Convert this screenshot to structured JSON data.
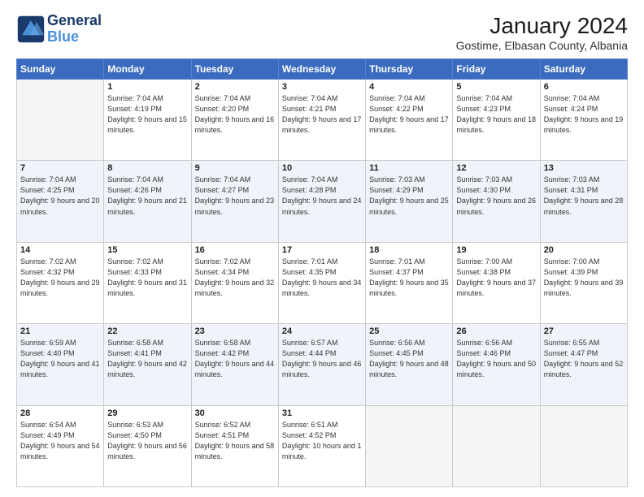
{
  "header": {
    "logo_line1": "General",
    "logo_line2": "Blue",
    "month": "January 2024",
    "location": "Gostime, Elbasan County, Albania"
  },
  "days_of_week": [
    "Sunday",
    "Monday",
    "Tuesday",
    "Wednesday",
    "Thursday",
    "Friday",
    "Saturday"
  ],
  "weeks": [
    [
      {
        "day": "",
        "empty": true
      },
      {
        "day": "1",
        "sunrise": "7:04 AM",
        "sunset": "4:19 PM",
        "daylight": "9 hours and 15 minutes."
      },
      {
        "day": "2",
        "sunrise": "7:04 AM",
        "sunset": "4:20 PM",
        "daylight": "9 hours and 16 minutes."
      },
      {
        "day": "3",
        "sunrise": "7:04 AM",
        "sunset": "4:21 PM",
        "daylight": "9 hours and 17 minutes."
      },
      {
        "day": "4",
        "sunrise": "7:04 AM",
        "sunset": "4:22 PM",
        "daylight": "9 hours and 17 minutes."
      },
      {
        "day": "5",
        "sunrise": "7:04 AM",
        "sunset": "4:23 PM",
        "daylight": "9 hours and 18 minutes."
      },
      {
        "day": "6",
        "sunrise": "7:04 AM",
        "sunset": "4:24 PM",
        "daylight": "9 hours and 19 minutes."
      }
    ],
    [
      {
        "day": "7",
        "sunrise": "7:04 AM",
        "sunset": "4:25 PM",
        "daylight": "9 hours and 20 minutes."
      },
      {
        "day": "8",
        "sunrise": "7:04 AM",
        "sunset": "4:26 PM",
        "daylight": "9 hours and 21 minutes."
      },
      {
        "day": "9",
        "sunrise": "7:04 AM",
        "sunset": "4:27 PM",
        "daylight": "9 hours and 23 minutes."
      },
      {
        "day": "10",
        "sunrise": "7:04 AM",
        "sunset": "4:28 PM",
        "daylight": "9 hours and 24 minutes."
      },
      {
        "day": "11",
        "sunrise": "7:03 AM",
        "sunset": "4:29 PM",
        "daylight": "9 hours and 25 minutes."
      },
      {
        "day": "12",
        "sunrise": "7:03 AM",
        "sunset": "4:30 PM",
        "daylight": "9 hours and 26 minutes."
      },
      {
        "day": "13",
        "sunrise": "7:03 AM",
        "sunset": "4:31 PM",
        "daylight": "9 hours and 28 minutes."
      }
    ],
    [
      {
        "day": "14",
        "sunrise": "7:02 AM",
        "sunset": "4:32 PM",
        "daylight": "9 hours and 29 minutes."
      },
      {
        "day": "15",
        "sunrise": "7:02 AM",
        "sunset": "4:33 PM",
        "daylight": "9 hours and 31 minutes."
      },
      {
        "day": "16",
        "sunrise": "7:02 AM",
        "sunset": "4:34 PM",
        "daylight": "9 hours and 32 minutes."
      },
      {
        "day": "17",
        "sunrise": "7:01 AM",
        "sunset": "4:35 PM",
        "daylight": "9 hours and 34 minutes."
      },
      {
        "day": "18",
        "sunrise": "7:01 AM",
        "sunset": "4:37 PM",
        "daylight": "9 hours and 35 minutes."
      },
      {
        "day": "19",
        "sunrise": "7:00 AM",
        "sunset": "4:38 PM",
        "daylight": "9 hours and 37 minutes."
      },
      {
        "day": "20",
        "sunrise": "7:00 AM",
        "sunset": "4:39 PM",
        "daylight": "9 hours and 39 minutes."
      }
    ],
    [
      {
        "day": "21",
        "sunrise": "6:59 AM",
        "sunset": "4:40 PM",
        "daylight": "9 hours and 41 minutes."
      },
      {
        "day": "22",
        "sunrise": "6:58 AM",
        "sunset": "4:41 PM",
        "daylight": "9 hours and 42 minutes."
      },
      {
        "day": "23",
        "sunrise": "6:58 AM",
        "sunset": "4:42 PM",
        "daylight": "9 hours and 44 minutes."
      },
      {
        "day": "24",
        "sunrise": "6:57 AM",
        "sunset": "4:44 PM",
        "daylight": "9 hours and 46 minutes."
      },
      {
        "day": "25",
        "sunrise": "6:56 AM",
        "sunset": "4:45 PM",
        "daylight": "9 hours and 48 minutes."
      },
      {
        "day": "26",
        "sunrise": "6:56 AM",
        "sunset": "4:46 PM",
        "daylight": "9 hours and 50 minutes."
      },
      {
        "day": "27",
        "sunrise": "6:55 AM",
        "sunset": "4:47 PM",
        "daylight": "9 hours and 52 minutes."
      }
    ],
    [
      {
        "day": "28",
        "sunrise": "6:54 AM",
        "sunset": "4:49 PM",
        "daylight": "9 hours and 54 minutes."
      },
      {
        "day": "29",
        "sunrise": "6:53 AM",
        "sunset": "4:50 PM",
        "daylight": "9 hours and 56 minutes."
      },
      {
        "day": "30",
        "sunrise": "6:52 AM",
        "sunset": "4:51 PM",
        "daylight": "9 hours and 58 minutes."
      },
      {
        "day": "31",
        "sunrise": "6:51 AM",
        "sunset": "4:52 PM",
        "daylight": "10 hours and 1 minute."
      },
      {
        "day": "",
        "empty": true
      },
      {
        "day": "",
        "empty": true
      },
      {
        "day": "",
        "empty": true
      }
    ]
  ],
  "labels": {
    "sunrise": "Sunrise:",
    "sunset": "Sunset:",
    "daylight": "Daylight:"
  }
}
